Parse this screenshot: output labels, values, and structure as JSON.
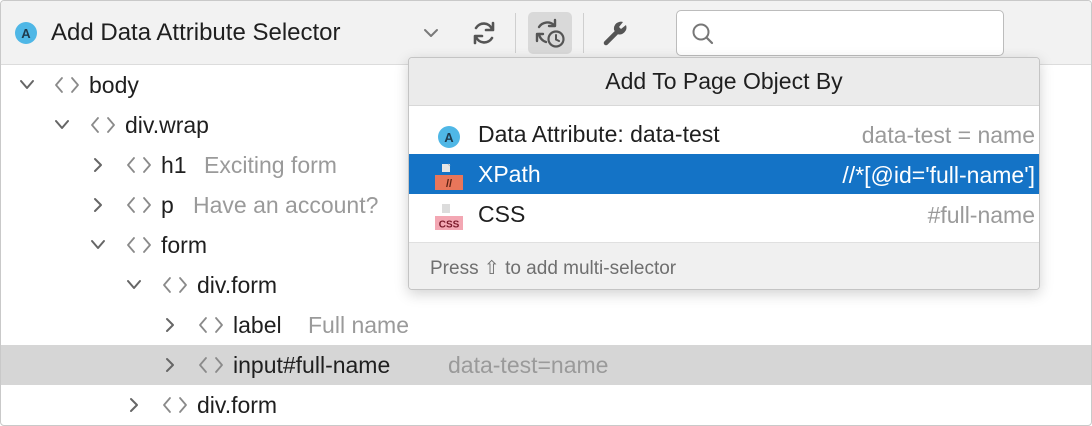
{
  "toolbar": {
    "selector_badge": "A",
    "selector_title": "Add Data Attribute Selector",
    "search_placeholder": "",
    "search_value": ""
  },
  "tree": {
    "rows": [
      {
        "label": "body",
        "hint": ""
      },
      {
        "label": "div.wrap",
        "hint": ""
      },
      {
        "label": "h1",
        "hint": "Exciting form"
      },
      {
        "label": "p",
        "hint": "Have an account?"
      },
      {
        "label": "form",
        "hint": ""
      },
      {
        "label": "div.form",
        "hint": ""
      },
      {
        "label": "label",
        "hint": "Full name"
      },
      {
        "label": "input#full-name",
        "hint": "data-test=name"
      },
      {
        "label": "div.form",
        "hint": ""
      }
    ]
  },
  "popup": {
    "title": "Add To Page Object By",
    "items": [
      {
        "badge": "A",
        "label": "Data Attribute: data-test",
        "value": "data-test = name"
      },
      {
        "badge": "//",
        "label": "XPath",
        "value": "//*[@id='full-name']"
      },
      {
        "badge": "CSS",
        "label": "CSS",
        "value": "#full-name"
      }
    ],
    "footer_prefix": "Press",
    "footer_key": "⇧",
    "footer_suffix": "to add multi-selector"
  },
  "colors": {
    "selection_blue": "#1473c6",
    "selected_row_gray": "#d6d6d6",
    "badge_blue": "#4fb7e6",
    "xpath_orange": "#e8765a",
    "css_pink": "#f3a7b3"
  }
}
